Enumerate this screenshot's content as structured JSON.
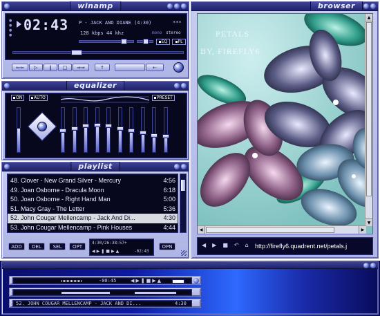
{
  "main": {
    "title": "winamp",
    "time": "02:43",
    "track_info": "P - JACK AND DIANE (4:30)",
    "info_tail": "***",
    "bitrate_line": "128 kbps 44 khz",
    "mono_label": "mono",
    "stereo_label": "stereo",
    "eq_badge": "EQ",
    "pl_badge": "PL",
    "buttons": [
      "⇐⇐",
      "▷",
      "∥",
      "□",
      "⇒⇒",
      "↑",
      "",
      "⇠"
    ],
    "left_indicators": [
      "●",
      "●",
      "●",
      "●"
    ]
  },
  "equalizer": {
    "title": "equalizer",
    "on_label": "ON",
    "auto_label": "AUTO",
    "preset_label": "PRESET",
    "preamp_level": 0.5,
    "bands": [
      0.5,
      0.55,
      0.6,
      0.62,
      0.6,
      0.55,
      0.5,
      0.45,
      0.4,
      0.38
    ]
  },
  "playlist": {
    "title": "playlist",
    "rows": [
      {
        "title": "48. Clover - New Grand Silver - Mercury",
        "length": "4:56"
      },
      {
        "title": "49. Joan Osborne - Dracula Moon",
        "length": "6:18"
      },
      {
        "title": "50. Joan Osborne - Right Hand Man",
        "length": "5:00"
      },
      {
        "title": "51. Macy Gray - The Letter",
        "length": "5:36"
      },
      {
        "title": "52. John Cougar Mellencamp - Jack And Di...",
        "length": "4:30"
      },
      {
        "title": "53. John Cougar Mellencamp - Pink Houses",
        "length": "4:44"
      }
    ],
    "selected_index": 4,
    "buttons": {
      "add": "ADD",
      "del": "DEL",
      "sel": "SEL",
      "opt": "OPT",
      "opn": "OPN"
    },
    "time_total": "4:30/26:38:57+",
    "time_small": "-02:43"
  },
  "browser": {
    "title": "browser",
    "image_text_line1": "PETALS",
    "image_text_line2": "BY, FIREFLY6",
    "url": "http://firefly6.quadrent.net/petals.j"
  },
  "mini": {
    "time": "-00:45",
    "track": "52. JOHN COUGAR MELLENCAMP - JACK AND DI...",
    "length": "4:30"
  },
  "colors": {
    "accent": "#1f2168",
    "lcd_bg": "#06071a",
    "frame": "#aeb4e4",
    "url_text": "#ffffff"
  }
}
